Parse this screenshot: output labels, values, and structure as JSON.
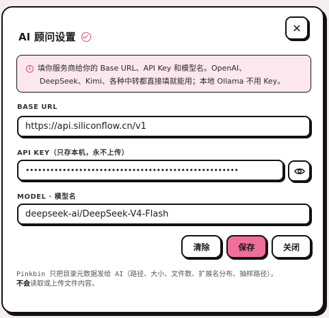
{
  "dialog": {
    "title": "AI 顾问设置",
    "close_label": "✕"
  },
  "notice": {
    "icon": "i",
    "line1": "填你服务商给你的 Base URL、API Key 和模型名。OpenAI、",
    "line2": "DeepSeek、Kimi、各种中转都直接填就能用；本地 Ollama 不用 Key。"
  },
  "base_url": {
    "label": "BASE URL",
    "value": "https://api.siliconflow.cn/v1"
  },
  "api_key": {
    "label": "API KEY（只存本机，永不上传）",
    "value": "••••••••••••••••••••••••••••••••••••••••••••••••••••"
  },
  "model": {
    "label": "MODEL · 模型名",
    "value": "deepseek-ai/DeepSeek-V4-Flash"
  },
  "actions": {
    "clear_label": "清除",
    "save_label": "保存",
    "close_label": "关闭"
  },
  "footer": {
    "text": "Pinkbin 只把目录元数据发给 AI（路径、大小、文件数、扩展名分布、抽样路径），",
    "emphasis": "不会",
    "text2": "读取或上传文件内容。"
  },
  "colors": {
    "accent": "#ef6f99",
    "notice_bg": "#fde7ee",
    "icon_pink": "#e0457b"
  },
  "icons": {
    "title_badge": "check-circle-icon",
    "close": "close-icon",
    "info": "info-icon",
    "reveal": "eye-icon"
  }
}
